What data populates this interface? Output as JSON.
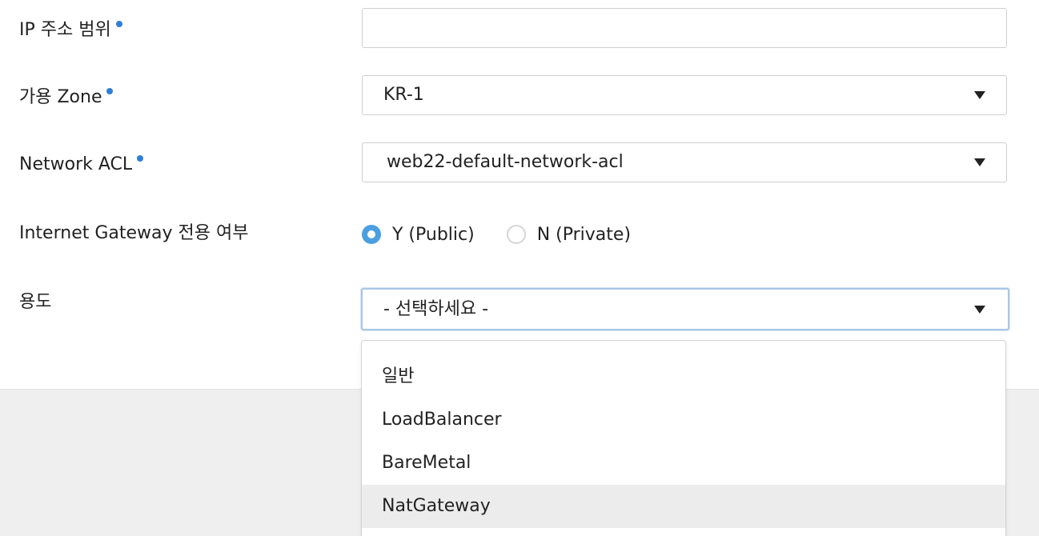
{
  "form": {
    "ip_range": {
      "label": "IP 주소 범위",
      "required": true,
      "value": ""
    },
    "zone": {
      "label": "가용 Zone",
      "required": true,
      "value": "KR-1"
    },
    "network_acl": {
      "label": "Network ACL",
      "required": true,
      "value": "web22-default-network-acl"
    },
    "internet_gateway": {
      "label": "Internet Gateway 전용 여부",
      "options": [
        {
          "label": "Y (Public)",
          "checked": true
        },
        {
          "label": "N (Private)",
          "checked": false
        }
      ]
    },
    "purpose": {
      "label": "용도",
      "value": "- 선택하세요 -",
      "options": [
        "일반",
        "LoadBalancer",
        "BareMetal",
        "NatGateway"
      ],
      "highlighted_option": "NatGateway"
    }
  },
  "colors": {
    "required_dot": "#2f7fd8",
    "radio_checked": "#4a9fe0",
    "focus_border": "#a9c6e6",
    "footer_bg": "#efefef",
    "option_highlight": "#ececec"
  },
  "icons": {
    "required": "required-dot-icon",
    "select_caret": "caret-down-icon",
    "radio": "radio-icon"
  }
}
